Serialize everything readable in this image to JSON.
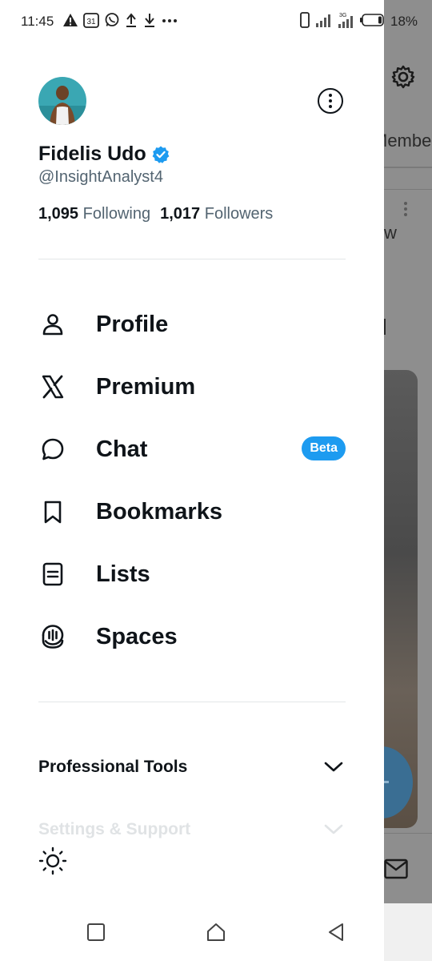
{
  "status_bar": {
    "time": "11:45",
    "calendar_day": "31",
    "network": "3G",
    "battery": "18%"
  },
  "background_app": {
    "header_fragment": "Membe",
    "row_fragment": "w"
  },
  "drawer": {
    "user": {
      "name": "Fidelis Udo",
      "handle": "@InsightAnalyst4",
      "verified": true,
      "following_count": "1,095",
      "following_label": "Following",
      "followers_count": "1,017",
      "followers_label": "Followers"
    },
    "menu": [
      {
        "label": "Profile",
        "icon": "person-icon"
      },
      {
        "label": "Premium",
        "icon": "x-logo-icon"
      },
      {
        "label": "Chat",
        "icon": "chat-bubble-icon",
        "badge": "Beta"
      },
      {
        "label": "Bookmarks",
        "icon": "bookmark-icon"
      },
      {
        "label": "Lists",
        "icon": "list-icon"
      },
      {
        "label": "Spaces",
        "icon": "spaces-icon"
      }
    ],
    "sections": [
      {
        "label": "Professional Tools",
        "icon": "chevron-down-icon"
      },
      {
        "label": "Settings & Support",
        "icon": "chevron-down-icon"
      }
    ],
    "theme_icon": "sun-icon"
  },
  "nav_bar": {
    "buttons": [
      "recents-icon",
      "home-icon",
      "back-icon"
    ]
  },
  "colors": {
    "accent": "#1d9bf0",
    "text_primary": "#0f1419",
    "text_secondary": "#536471",
    "divider": "#e3e6e8",
    "overlay": "#8e8e8e"
  }
}
